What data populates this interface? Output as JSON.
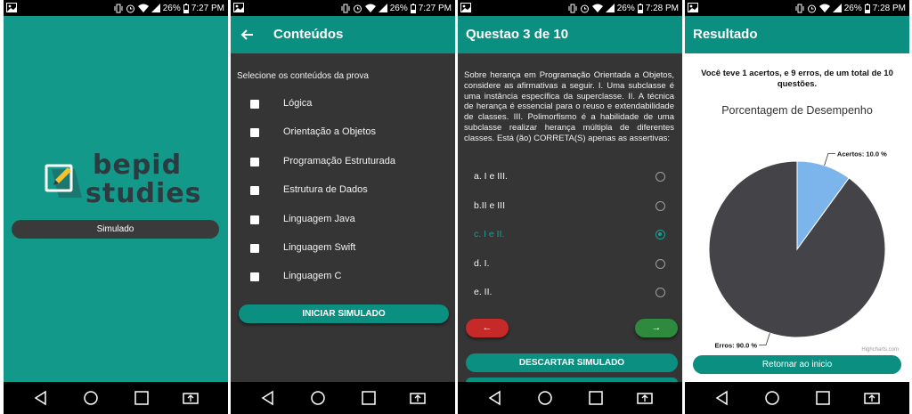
{
  "colors": {
    "teal": "#0b8f80",
    "teal_bg": "#12998a",
    "dark_bg": "#353535",
    "accent_selected": "#15a393",
    "danger": "#c62a28",
    "success": "#2e8b3e",
    "pie_errors": "#434348",
    "pie_hits": "#7cb5ec"
  },
  "status_bar": {
    "battery": "26%",
    "times": [
      "7:27 PM",
      "7:27 PM",
      "7:28 PM",
      "7:28 PM"
    ],
    "icons": [
      "gallery-icon",
      "vibrate-icon",
      "alarm-icon",
      "wifi-icon",
      "signal-icon",
      "battery-icon"
    ]
  },
  "nav_bar": {
    "icons": [
      "back-icon",
      "home-icon",
      "recents-icon",
      "rotate-icon"
    ]
  },
  "screen1": {
    "logo_line1": "bepid",
    "logo_line2": "studies",
    "button_label": "Simulado"
  },
  "screen2": {
    "title": "Conteúdos",
    "subtitle": "Selecione os conteúdos da prova",
    "items": [
      "Lógica",
      "Orientação a Objetos",
      "Programação Estruturada",
      "Estrutura de Dados",
      "Linguagem Java",
      "Linguagem Swift",
      "Linguagem C"
    ],
    "start_button": "INICIAR SIMULADO"
  },
  "screen3": {
    "title": "Questao 3 de 10",
    "question": "Sobre herança em Programação Orientada a Objetos, considere as afirmativas a seguir. I. Uma subclasse é uma instância específica da superclasse. II. A técnica de herança é essencial para o reuso e extendabilidade de classes. III. Polimorfismo é a habilidade de uma subclasse realizar herança múltipla de diferentes classes. Está (ão) CORRETA(S) apenas as assertivas:",
    "options": [
      "a. I e III.",
      "b.II e III",
      "c. I e II.",
      "d. I.",
      "e. II."
    ],
    "selected_index": 2,
    "prev_symbol": "←",
    "next_symbol": "→",
    "discard_button": "DESCARTAR SIMULADO"
  },
  "screen4": {
    "title": "Resultado",
    "summary": "Você teve 1 acertos, e 9 erros, de um total de 10 questões.",
    "chart_credits": "Highcharts.com",
    "return_button": "Retornar ao inicio"
  },
  "chart_data": {
    "type": "pie",
    "title": "Porcentagem de Desempenho",
    "slices": [
      {
        "label": "Acertos: 10.0 %",
        "value": 10.0,
        "color": "#7cb5ec"
      },
      {
        "label": "Erros: 90.0 %",
        "value": 90.0,
        "color": "#434348"
      }
    ]
  }
}
